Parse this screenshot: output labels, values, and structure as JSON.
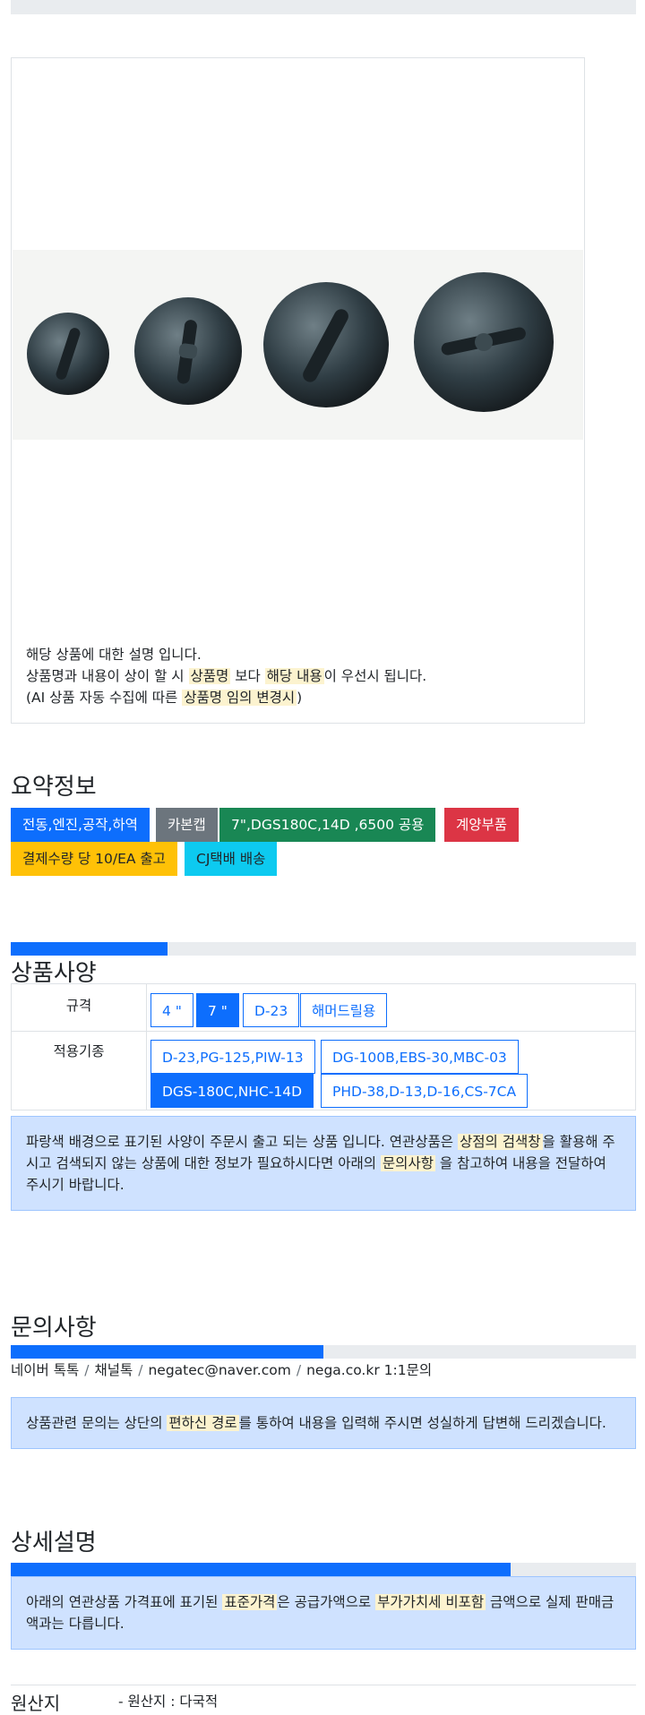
{
  "description": {
    "line1": "해당 상품에 대한 설명 입니다.",
    "line2_a": "상품명과 내용이 상이 할 시 ",
    "line2_mark1": "상품명",
    "line2_b": " 보다 ",
    "line2_mark2": "해당 내용",
    "line2_c": "이 우선시 됩니다.",
    "line3_a": "(AI 상품 자동 수집에 따른 ",
    "line3_mark": "상품명 임의 변경시",
    "line3_b": ")"
  },
  "summary": {
    "title": "요약정보",
    "badges": [
      {
        "label": "전동,엔진,공작,하역",
        "color": "#0d6efd"
      },
      {
        "label": "카본캡",
        "color": "#6c757d"
      },
      {
        "label": "7\",DGS180C,14D ,6500 공용",
        "color": "#198754"
      },
      {
        "label": "계양부품",
        "color": "#dc3545"
      },
      {
        "label": "결제수량 당 10/EA 출고",
        "color": "#ffc107"
      },
      {
        "label": "CJ택배 배송",
        "color": "#0dcaf0"
      }
    ]
  },
  "spec": {
    "title": "상품사양",
    "progress_fraction": 0.25,
    "rows": [
      {
        "label": "규격",
        "options": [
          {
            "label": "4 \"",
            "selected": false
          },
          {
            "label": "7 \"",
            "selected": true
          },
          {
            "label": "D-23",
            "selected": false
          },
          {
            "label": "해머드릴용",
            "selected": false
          }
        ]
      },
      {
        "label": "적용기종",
        "options": [
          {
            "label": "D-23,PG-125,PIW-13",
            "selected": false
          },
          {
            "label": "DG-100B,EBS-30,MBC-03",
            "selected": false
          },
          {
            "label": "DGS-180C,NHC-14D",
            "selected": true
          },
          {
            "label": "PHD-38,D-13,D-16,CS-7CA",
            "selected": false
          }
        ]
      }
    ],
    "notice_a": "파랑색 배경으로 표기된 사양이 주문시 출고 되는 상품 입니다. 연관상품은 ",
    "notice_mark1": "상점의 검색창",
    "notice_b": "을 활용해 주시고 검색되지 않는 상품에 대한 정보가 필요하시다면 아래의 ",
    "notice_mark2": "문의사항",
    "notice_c": " 을 참고하여 내용을 전달하여 주시기 바랍니다."
  },
  "inquiry": {
    "title": "문의사항",
    "progress_fraction": 0.5,
    "contacts": [
      "네이버 톡톡",
      "채널톡",
      "negatec@naver.com",
      "nega.co.kr 1:1문의"
    ],
    "notice_a": "상품관련 문의는 상단의 ",
    "notice_mark": "편하신 경로",
    "notice_b": "를 통하여 내용을 입력해 주시면 성실하게 답변해 드리겠습니다."
  },
  "detail": {
    "title": "상세설명",
    "progress_fraction": 0.8,
    "notice_a": "아래의 연관상품 가격표에 표기된 ",
    "notice_mark1": "표준가격",
    "notice_b": "은 공급가액으로 ",
    "notice_mark2": "부가가치세 비포함",
    "notice_c": " 금액으로 실제 판매금액과는 다릅니다."
  },
  "origin": {
    "title": "원산지",
    "value": "- 원산지 : 다국적"
  }
}
